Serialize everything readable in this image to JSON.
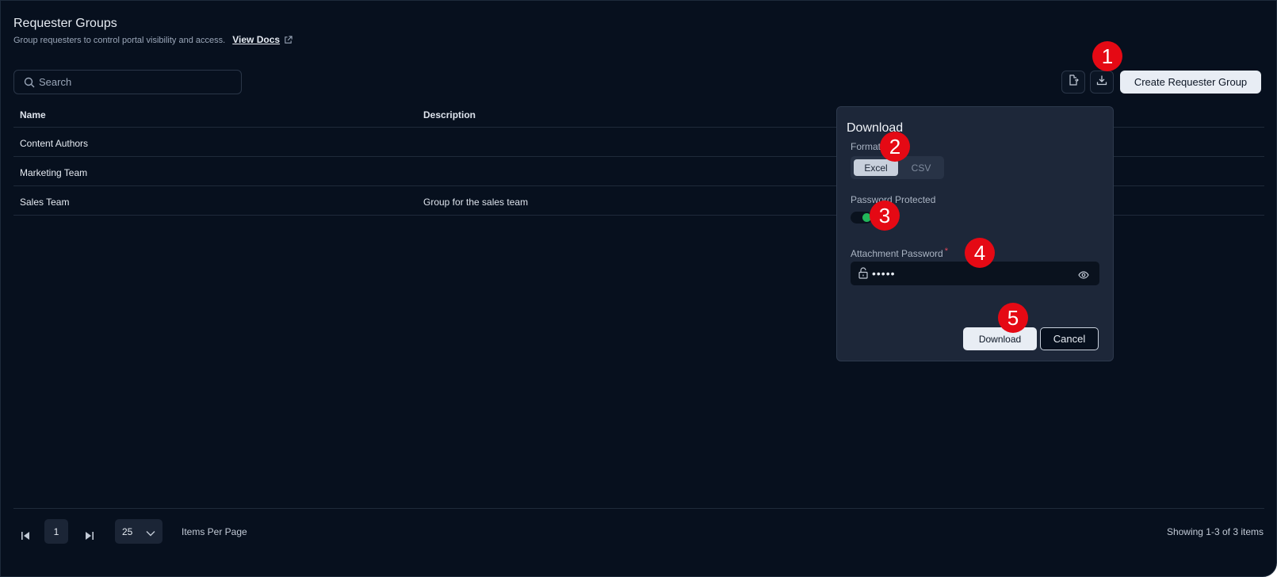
{
  "header": {
    "title": "Requester Groups",
    "subtitle": "Group requesters to control portal visibility and access.",
    "docs_link": "View Docs"
  },
  "search": {
    "placeholder": "Search",
    "value": ""
  },
  "toolbar": {
    "export_icon": "file-export-icon",
    "download_icon": "download-icon",
    "create_label": "Create Requester Group"
  },
  "table": {
    "headers": [
      "Name",
      "Description"
    ],
    "rows": [
      {
        "name": "Content Authors",
        "description": ""
      },
      {
        "name": "Marketing Team",
        "description": ""
      },
      {
        "name": "Sales Team",
        "description": "Group for the sales team"
      }
    ]
  },
  "pagination": {
    "current_page": "1",
    "page_size": "25",
    "items_per_page_label": "Items Per Page",
    "showing": "Showing 1-3 of 3 items"
  },
  "download_dialog": {
    "title": "Download",
    "format_label": "Format",
    "formats": [
      "Excel",
      "CSV"
    ],
    "selected_format": "Excel",
    "password_protected_label": "Password Protected",
    "password_protected": true,
    "attachment_password_label": "Attachment Password",
    "required_mark": "*",
    "password_value": "•••••",
    "download_label": "Download",
    "cancel_label": "Cancel"
  },
  "markers": [
    "1",
    "2",
    "3",
    "4",
    "5"
  ],
  "colors": {
    "background": "#07101e",
    "panel": "#1d2739",
    "primary_button": "#e8edf4",
    "toggle_on": "#22b65a",
    "marker": "#e50914",
    "required": "#e0475a"
  }
}
